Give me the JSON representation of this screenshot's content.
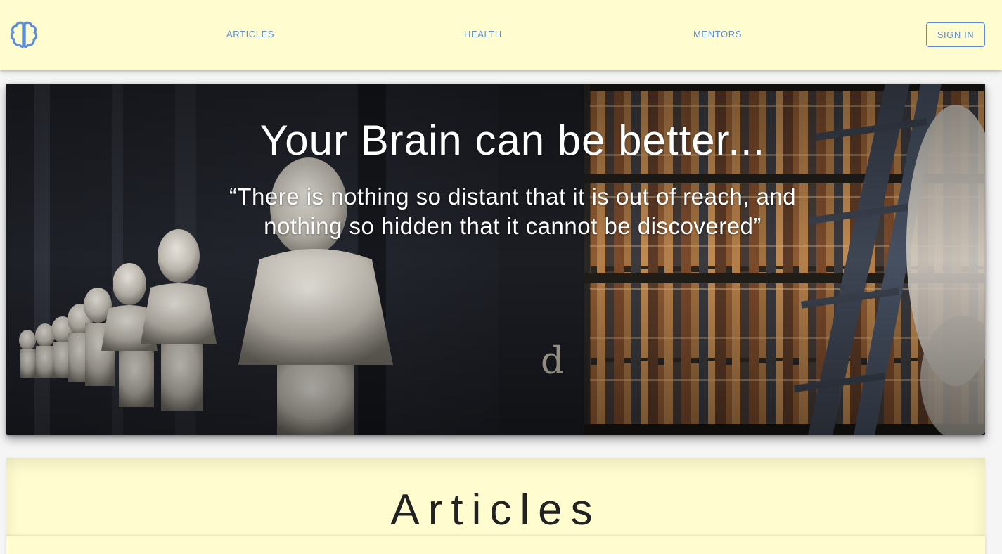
{
  "header": {
    "logo_icon": "brain-icon",
    "nav": [
      {
        "label": "ARTICLES"
      },
      {
        "label": "HEALTH"
      },
      {
        "label": "MENTORS"
      }
    ],
    "signin_label": "SIGN IN"
  },
  "hero": {
    "title": "Your Brain can be better...",
    "quote": "“There is nothing so distant that it is out of reach, and nothing so hidden that it cannot be discovered”",
    "image": "library-busts-bookshelves-photo"
  },
  "articles": {
    "title": "Articles"
  },
  "colors": {
    "header_bg": "#fffdcf",
    "accent": "#5c8ddb",
    "section_bg": "#fffdcf",
    "heading_text": "#222222"
  }
}
